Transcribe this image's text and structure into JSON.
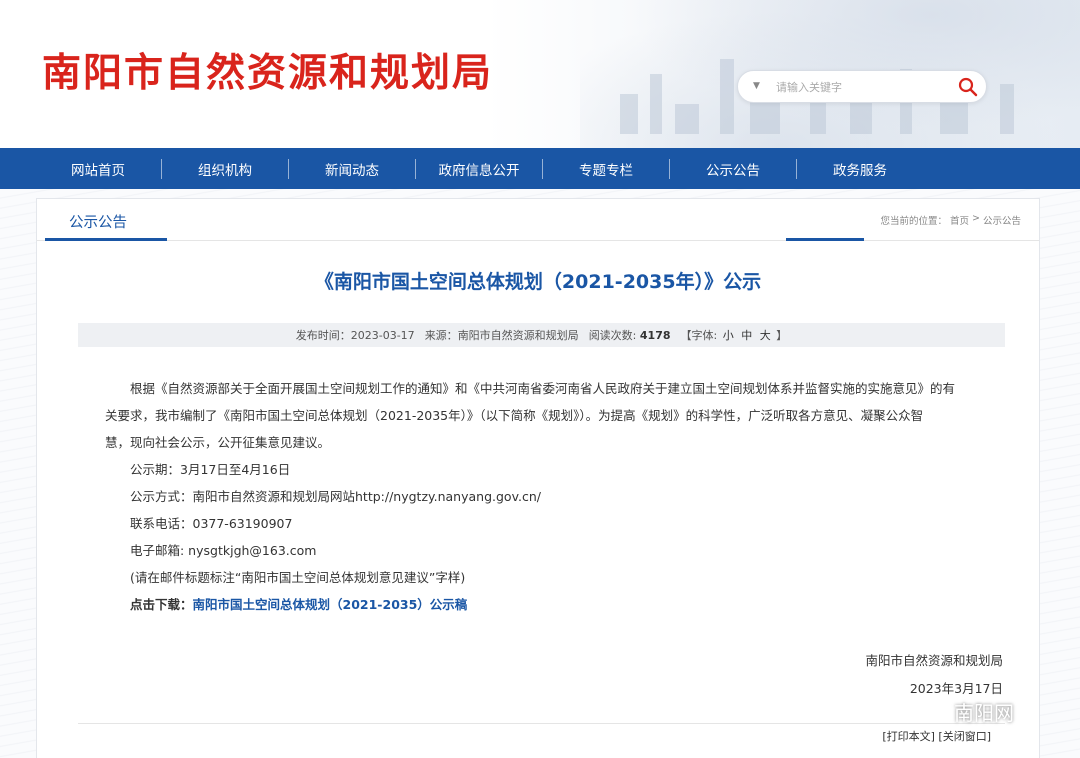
{
  "header": {
    "site_title": "南阳市自然资源和规划局",
    "search_placeholder": "请输入关键字"
  },
  "nav": {
    "items": [
      "网站首页",
      "组织机构",
      "新闻动态",
      "政府信息公开",
      "专题专栏",
      "公示公告",
      "政务服务"
    ]
  },
  "section": {
    "title": "公示公告",
    "breadcrumb_prefix": "您当前的位置：",
    "breadcrumb_home": "首页",
    "breadcrumb_sep": ">",
    "breadcrumb_current": "公示公告"
  },
  "article": {
    "title": "《南阳市国土空间总体规划（2021-2035年）》公示",
    "meta": {
      "publish_label": "发布时间：",
      "publish_date": "2023-03-17",
      "source_label": "来源：",
      "source": "南阳市自然资源和规划局",
      "views_label": "阅读次数:",
      "views": "4178",
      "font_label_open": "【字体:",
      "font_small": "小",
      "font_medium": "中",
      "font_large": "大",
      "font_label_close": "】"
    },
    "para_line1": "根据《自然资源部关于全面开展国土空间规划工作的通知》和《中共河南省委河南省人民政府关于建立国土空间规划体系并监督实施的实施意见》的有",
    "para_line2": "关要求，我市编制了《南阳市国土空间总体规划（2021-2035年）》（以下简称《规划》）。为提高《规划》的科学性，广泛听取各方意见、凝聚公众智",
    "para_line3": "慧，现向社会公示，公开征集意见建议。",
    "period": "公示期：3月17日至4月16日",
    "method": "公示方式：南阳市自然资源和规划局网站http://nygtzy.nanyang.gov.cn/",
    "phone": "联系电话：0377-63190907",
    "email": "电子邮箱: nysgtkjgh@163.com",
    "note": "(请在邮件标题标注“南阳市国土空间总体规划意见建议”字样)",
    "download_label": "点击下载：",
    "download_link": "南阳市国土空间总体规划（2021-2035）公示稿",
    "signature_org": "南阳市自然资源和规划局",
    "signature_date": "2023年3月17日"
  },
  "footer": {
    "print_label": "[打印本文]",
    "close_label": "[关闭窗口]"
  },
  "watermark": {
    "text": "南阳网"
  },
  "colors": {
    "brand_red": "#d9241c",
    "nav_blue": "#1a56a5"
  }
}
